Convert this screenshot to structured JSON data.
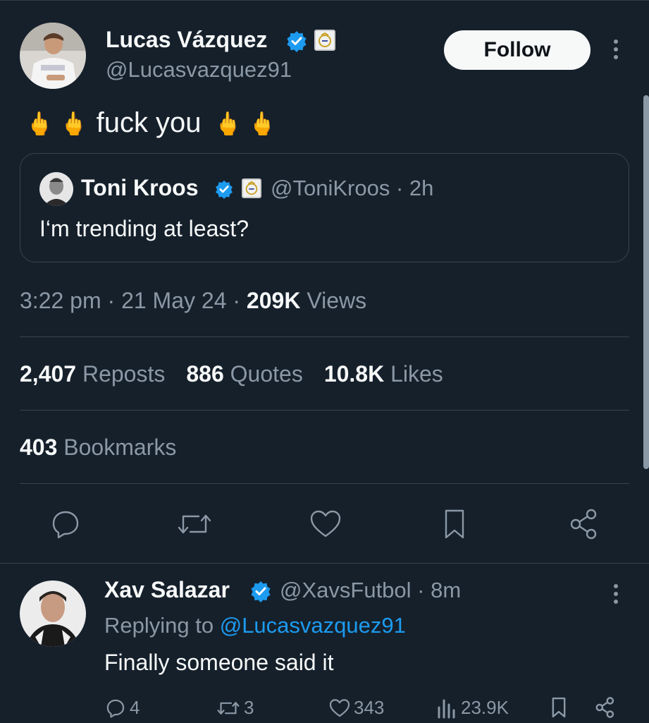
{
  "tweet": {
    "author": {
      "name": "Lucas Vázquez",
      "handle": "@Lucasvazquez91"
    },
    "follow_label": "Follow",
    "emoji_left": "🖕 🖕",
    "text": "fuck you",
    "emoji_right": "🖕 🖕",
    "quote": {
      "author_name": "Toni Kroos",
      "handle": "@ToniKroos",
      "time": "· 2h",
      "text": "I‘m trending at least?"
    },
    "time": "3:22 pm",
    "date": "· 21 May 24 ·",
    "views_count": "209K",
    "views_label": "Views",
    "stats": {
      "reposts_count": "2,407",
      "reposts_label": "Reposts",
      "quotes_count": "886",
      "quotes_label": "Quotes",
      "likes_count": "10.8K",
      "likes_label": "Likes",
      "bookmarks_count": "403",
      "bookmarks_label": "Bookmarks"
    }
  },
  "reply": {
    "author_name": "Xav Salazar",
    "handle": "@XavsFutbol",
    "time": "· 8m",
    "replying_prefix": "Replying to",
    "replying_to": "@Lucasvazquez91",
    "text": "Finally someone said it",
    "replies": "4",
    "reposts": "3",
    "likes": "343",
    "views": "23.9K"
  },
  "colors": {
    "background": "#15202b",
    "accent": "#1d9bf0",
    "muted": "#8b98a5"
  }
}
